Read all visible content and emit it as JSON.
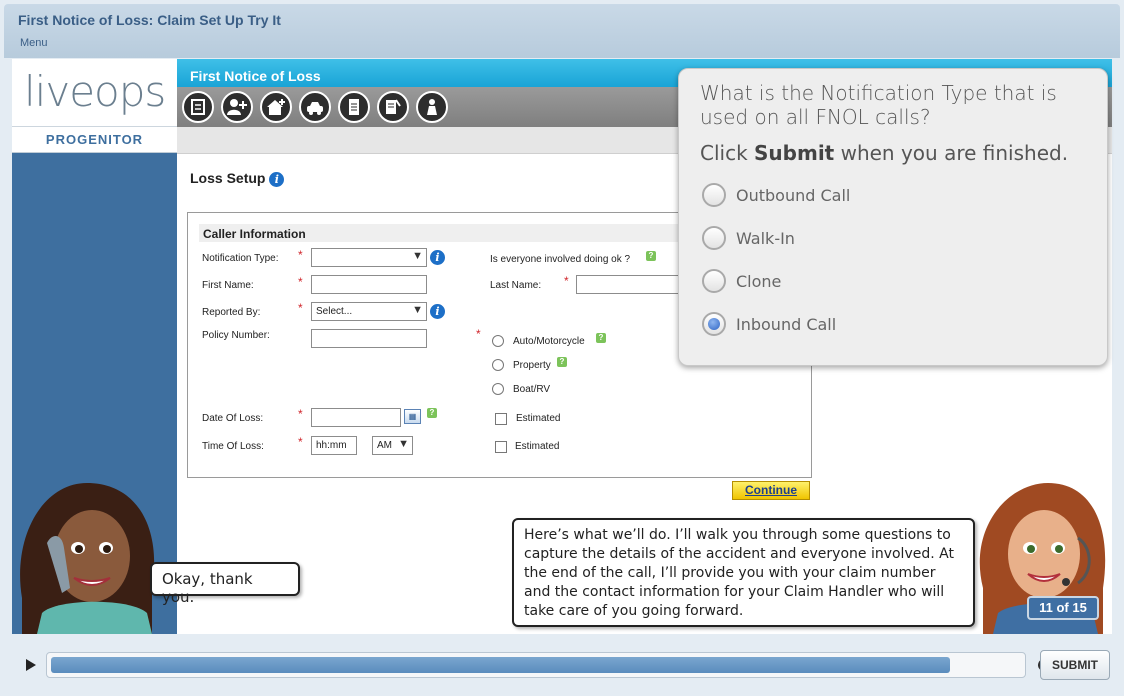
{
  "course": {
    "title": "First Notice of Loss: Claim Set Up Try It",
    "menu_label": "Menu"
  },
  "app": {
    "logo_text": "liveops",
    "logo_subtext": "PROGENITOR",
    "header_title": "First Notice of Loss",
    "toolbar_icons": [
      "notes-icon",
      "add-person-icon",
      "add-home-icon",
      "vehicle-icon",
      "document-icon",
      "edit-document-icon",
      "person-icon"
    ]
  },
  "form": {
    "page_heading": "Loss Setup",
    "section_title": "Caller Information",
    "notification_type_label": "Notification Type:",
    "notification_type_value": "",
    "everyone_ok_label": "Is everyone involved doing ok ?",
    "first_name_label": "First Name:",
    "first_name_value": "",
    "last_name_label": "Last Name:",
    "last_name_value": "",
    "reported_by_label": "Reported By:",
    "reported_by_value": "Select...",
    "policy_number_label": "Policy Number:",
    "policy_number_value": "",
    "vehicle_options": [
      "Auto/Motorcycle",
      "Property",
      "Boat/RV"
    ],
    "date_of_loss_label": "Date Of Loss:",
    "date_of_loss_value": "",
    "time_of_loss_label": "Time Of Loss:",
    "time_of_loss_placeholder": "hh:mm",
    "ampm_value": "AM",
    "estimated_label": "Estimated",
    "continue_label": "Continue"
  },
  "question": {
    "text": "What is the Notification Type that is used on all FNOL calls?",
    "instruction_prefix": "Click ",
    "instruction_bold": "Submit",
    "instruction_suffix": " when you are finished.",
    "options": [
      {
        "label": "Outbound Call",
        "selected": false
      },
      {
        "label": "Walk-In",
        "selected": false
      },
      {
        "label": "Clone",
        "selected": false
      },
      {
        "label": "Inbound Call",
        "selected": true
      }
    ]
  },
  "dialogue": {
    "caller_line": "Okay, thank you.",
    "agent_line": "Here’s what we’ll do.  I’ll walk you through some questions to capture the details of the accident and everyone involved.  At the end of the call, I’ll provide you with your claim number and the contact information for your Claim Handler who will take care of you going forward."
  },
  "player": {
    "slide_counter": "11 of 15",
    "submit_label": "SUBMIT",
    "progress_fraction": 0.95
  },
  "colors": {
    "accent_blue": "#3e6f9f",
    "header_cyan": "#19a4d6",
    "continue_yellow": "#f0c400",
    "required_red": "#d0262c"
  }
}
